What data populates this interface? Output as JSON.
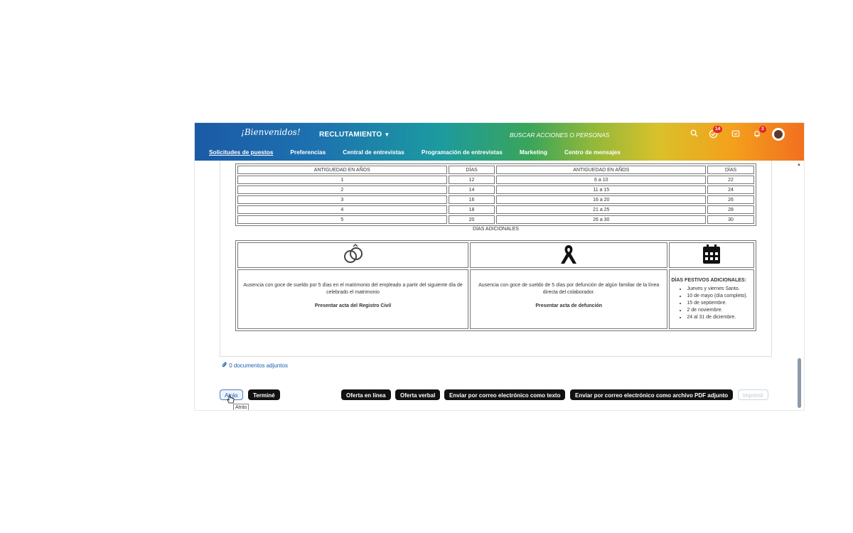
{
  "header": {
    "logo_text": "¡Bienvenidos!",
    "module_label": "RECLUTAMIENTO",
    "search_placeholder": "BUSCAR ACCIONES O PERSONAS",
    "todo_badge": "14",
    "notif_badge": "3"
  },
  "nav": {
    "items": [
      "Solicitudes de puestos",
      "Preferencias",
      "Central de entrevistas",
      "Programación de entrevistas",
      "Marketing",
      "Centro de mensajes"
    ]
  },
  "antiguedad": {
    "headers": [
      "ANTIGUEDAD EN AÑOS",
      "DÍAS",
      "ANTIGUEDAD EN AÑOS",
      "DÍAS"
    ],
    "rows": [
      [
        "1",
        "12",
        "6 a 10",
        "22"
      ],
      [
        "2",
        "14",
        "11 a 15",
        "24"
      ],
      [
        "3",
        "16",
        "16 a 20",
        "26"
      ],
      [
        "4",
        "18",
        "21 a 25",
        "28"
      ],
      [
        "5",
        "20",
        "26 a 30",
        "30"
      ]
    ]
  },
  "dias_adicionales": {
    "title": "DÍAS ADICIONALES",
    "matrimonio_text": "Ausencia con goce de sueldo por 5 días en el matrimonio del empleado a partir del siguiente día de celebrado el matrimonio",
    "matrimonio_req": "Presentar acta del Registro Civil",
    "defuncion_text": "Ausencia con goce de sueldo de 5 días por defunción de algún familiar de la línea directa del colaborador.",
    "defuncion_req": "Presentar acta de defunción",
    "festivos_title": "DÍAS FESTIVOS ADICIONALES:",
    "festivos": [
      "Jueves y viernes Santo.",
      "10 de mayo (día completo).",
      "15 de septiembre.",
      "2 de noviembre.",
      "24 al 31 de diciembre."
    ]
  },
  "attachments": {
    "label": "0 documentos adjuntos"
  },
  "buttons": {
    "back": "Atrás",
    "done": "Terminé",
    "online_offer": "Oferta en línea",
    "verbal_offer": "Oferta verbal",
    "email_text": "Enviar por correo electrónico como texto",
    "email_pdf": "Enviar por correo electrónico como archivo PDF adjunto",
    "print": "Imprimir"
  },
  "tooltip": "Atrás",
  "colors": {
    "badge": "#e2272a",
    "primary_button": "#111111",
    "link": "#1a5fb4"
  }
}
